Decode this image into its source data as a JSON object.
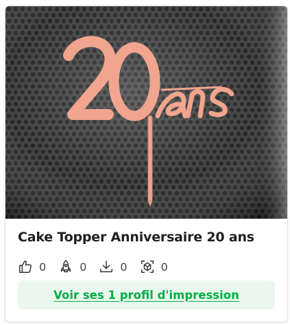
{
  "card": {
    "title": "Cake Topper Anniversaire 20 ans",
    "image_alt_icon": "cake-topper-photo",
    "stats": [
      {
        "icon": "thumbs-up-icon",
        "count": "0"
      },
      {
        "icon": "rocket-icon",
        "count": "0"
      },
      {
        "icon": "download-icon",
        "count": "0"
      },
      {
        "icon": "3d-box-icon",
        "count": "0"
      }
    ],
    "profile_button": "Voir ses 1 profil d'impression"
  },
  "colors": {
    "accent": "#00ae42",
    "button_bg": "#eaf7ee",
    "topper": "#f1a58e"
  }
}
